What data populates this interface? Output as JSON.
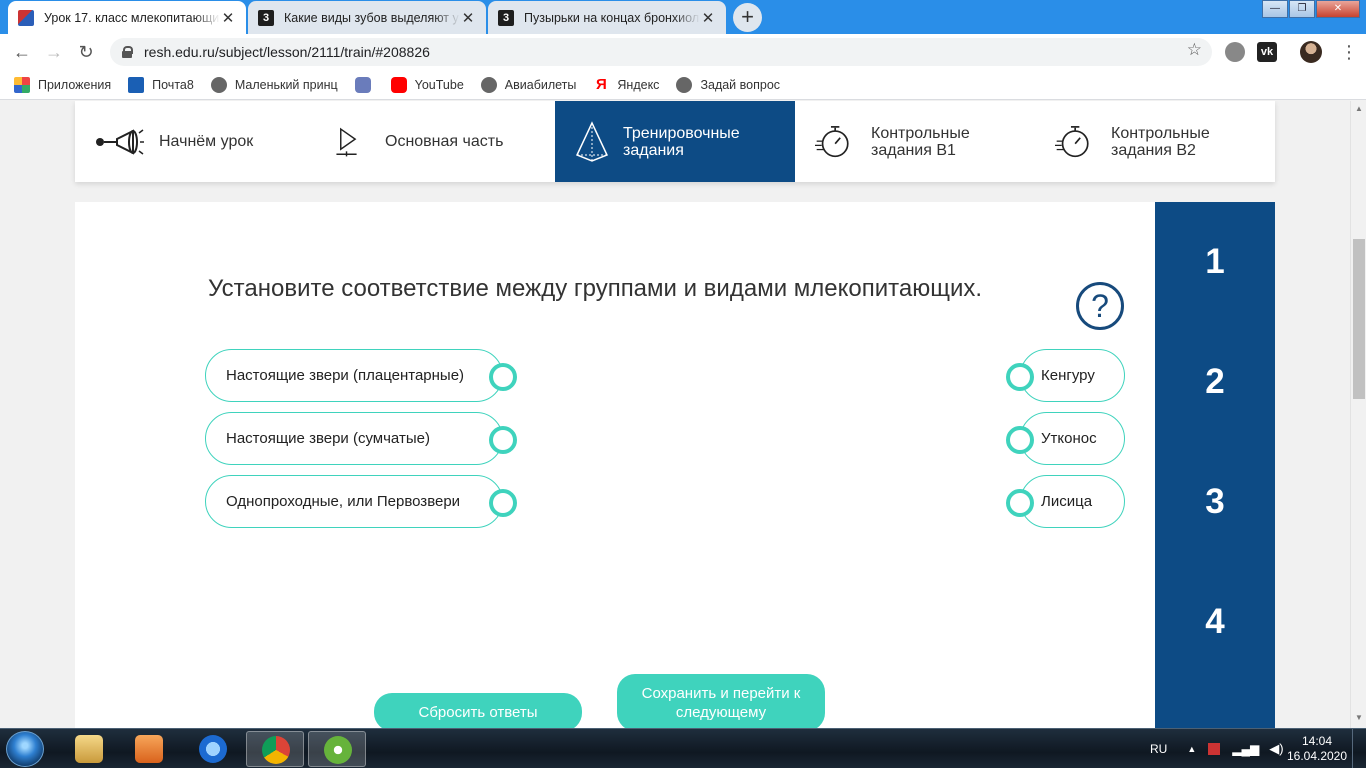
{
  "browser": {
    "tabs": [
      {
        "title": "Урок 17. класс млекопитающие",
        "active": true,
        "icon": "resh-icon"
      },
      {
        "title": "Какие виды зубов выделяют у м",
        "active": false,
        "icon": "znanija-icon"
      },
      {
        "title": "Пузырьки на концах бронхиол",
        "active": false,
        "icon": "znanija-icon"
      }
    ],
    "new_tab": "+",
    "window_buttons": {
      "minimize": "—",
      "maximize": "❐",
      "close": "✕"
    },
    "url": "resh.edu.ru/subject/lesson/2111/train/#208826",
    "bookmarks": [
      "Приложения",
      "Почта8",
      "Маленький принц",
      "YouTube",
      "Авиабилеты",
      "Яндекс",
      "Задай вопрос"
    ],
    "ya_glyph": "Я"
  },
  "lesson_nav": {
    "items": [
      {
        "label": "Начнём урок",
        "icon": "megaphone-icon"
      },
      {
        "label": "Основная часть",
        "icon": "play-icon"
      },
      {
        "label": "Тренировочные задания",
        "icon": "pyramid-icon",
        "active": true
      },
      {
        "label": "Контрольные задания В1",
        "icon": "stopwatch-icon"
      },
      {
        "label": "Контрольные задания В2",
        "icon": "stopwatch-icon"
      }
    ]
  },
  "task": {
    "question": "Установите соответствие между группами и видами млекопитающих.",
    "help_symbol": "?",
    "left_items": [
      "Настоящие звери (плацентарные)",
      "Настоящие звери (сумчатые)",
      "Однопроходные, или Первозвери"
    ],
    "right_items": [
      "Кенгуру",
      "Утконос",
      "Лисица"
    ],
    "reset_label": "Сбросить ответы",
    "save_label": "Сохранить и перейти к следующему"
  },
  "steps": [
    "1",
    "2",
    "3",
    "4"
  ],
  "taskbar": {
    "language": "RU",
    "time": "14:04",
    "date": "16.04.2020"
  },
  "colors": {
    "accent_dark_blue": "#0d4b85",
    "accent_teal": "#3fd3bd",
    "chrome_blue": "#2a8ee8"
  }
}
